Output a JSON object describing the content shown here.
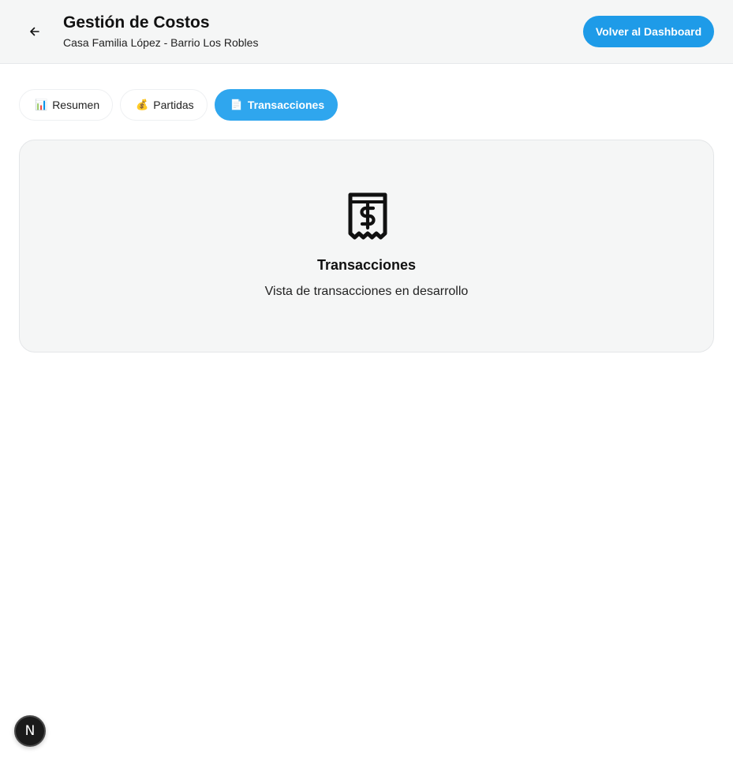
{
  "header": {
    "title": "Gestión de Costos",
    "subtitle": "Casa Familia López - Barrio Los Robles",
    "back_icon": "arrow-left-icon",
    "dashboard_button": "Volver al Dashboard"
  },
  "tabs": [
    {
      "icon": "📊",
      "label": "Resumen",
      "active": false
    },
    {
      "icon": "💰",
      "label": "Partidas",
      "active": false
    },
    {
      "icon": "📄",
      "label": "Transacciones",
      "active": true
    }
  ],
  "panel": {
    "icon": "receipt-dollar-icon",
    "title": "Transacciones",
    "description": "Vista de transacciones en desarrollo"
  },
  "dev_badge": {
    "letter": "N"
  },
  "colors": {
    "accent": "#1e9be8",
    "active_tab": "#2fa6ee",
    "header_bg": "#f5f6f6"
  }
}
